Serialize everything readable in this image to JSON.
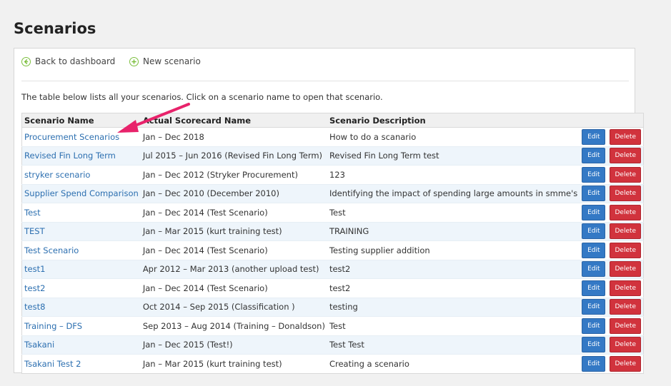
{
  "page": {
    "title": "Scenarios"
  },
  "toolbar": {
    "back_label": "Back to dashboard",
    "new_label": "New scenario",
    "icon_color": "#7cbf3e"
  },
  "intro": "The table below lists all your scenarios. Click on a scenario name to open that scenario.",
  "table": {
    "headers": [
      "Scenario Name",
      "Actual Scorecard Name",
      "Scenario Description"
    ],
    "edit_label": "Edit",
    "delete_label": "Delete",
    "rows": [
      {
        "name": "Procurement Scenarios",
        "scorecard": "Jan – Dec 2018",
        "description": "How to do a scanario"
      },
      {
        "name": "Revised Fin Long Term",
        "scorecard": "Jul 2015 – Jun 2016 (Revised Fin Long Term)",
        "description": "Revised Fin Long Term test"
      },
      {
        "name": "stryker scenario",
        "scorecard": "Jan – Dec 2012 (Stryker Procurement)",
        "description": "123"
      },
      {
        "name": "Supplier Spend Comparison",
        "scorecard": "Jan – Dec 2010 (December 2010)",
        "description": "Identifying the impact of spending large amounts in smme's"
      },
      {
        "name": "Test",
        "scorecard": "Jan – Dec 2014 (Test Scenario)",
        "description": "Test"
      },
      {
        "name": "TEST",
        "scorecard": "Jan – Mar 2015 (kurt training test)",
        "description": "TRAINING"
      },
      {
        "name": "Test Scenario",
        "scorecard": "Jan – Dec 2014 (Test Scenario)",
        "description": "Testing supplier addition"
      },
      {
        "name": "test1",
        "scorecard": "Apr 2012 – Mar 2013 (another upload test)",
        "description": "test2"
      },
      {
        "name": "test2",
        "scorecard": "Jan – Dec 2014 (Test Scenario)",
        "description": "test2"
      },
      {
        "name": "test8",
        "scorecard": "Oct 2014 – Sep 2015 (Classification )",
        "description": "testing"
      },
      {
        "name": "Training – DFS",
        "scorecard": "Sep 2013 – Aug 2014 (Training – Donaldson)",
        "description": "Test"
      },
      {
        "name": "Tsakani",
        "scorecard": "Jan – Dec 2015 (Test!)",
        "description": "Test Test"
      },
      {
        "name": "Tsakani Test 2",
        "scorecard": "Jan – Mar 2015 (kurt training test)",
        "description": "Creating a scenario"
      }
    ]
  },
  "colors": {
    "link": "#2c6fb0",
    "edit_button": "#3479c5",
    "delete_button": "#d1333d",
    "annotation_arrow": "#e8236b"
  }
}
